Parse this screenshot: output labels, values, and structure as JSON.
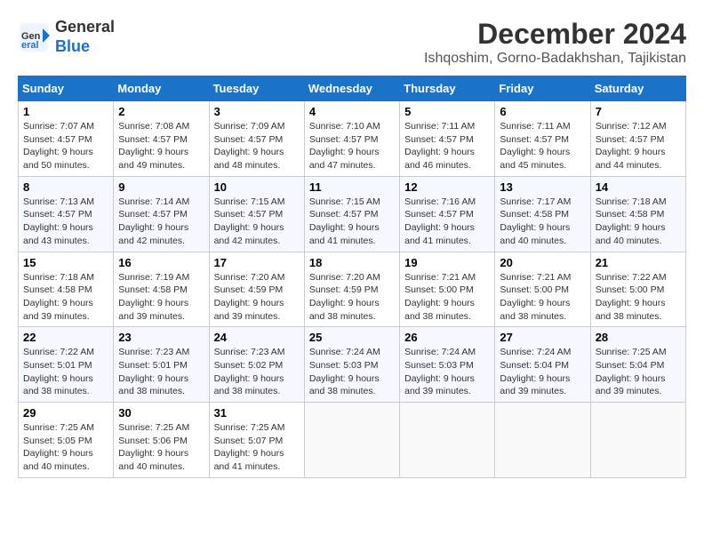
{
  "header": {
    "logo_line1": "General",
    "logo_line2": "Blue",
    "month": "December 2024",
    "location": "Ishqoshim, Gorno-Badakhshan, Tajikistan"
  },
  "weekdays": [
    "Sunday",
    "Monday",
    "Tuesday",
    "Wednesday",
    "Thursday",
    "Friday",
    "Saturday"
  ],
  "weeks": [
    [
      {
        "day": 1,
        "sunrise": "7:07 AM",
        "sunset": "4:57 PM",
        "daylight": "9 hours and 50 minutes"
      },
      {
        "day": 2,
        "sunrise": "7:08 AM",
        "sunset": "4:57 PM",
        "daylight": "9 hours and 49 minutes"
      },
      {
        "day": 3,
        "sunrise": "7:09 AM",
        "sunset": "4:57 PM",
        "daylight": "9 hours and 48 minutes"
      },
      {
        "day": 4,
        "sunrise": "7:10 AM",
        "sunset": "4:57 PM",
        "daylight": "9 hours and 47 minutes"
      },
      {
        "day": 5,
        "sunrise": "7:11 AM",
        "sunset": "4:57 PM",
        "daylight": "9 hours and 46 minutes"
      },
      {
        "day": 6,
        "sunrise": "7:11 AM",
        "sunset": "4:57 PM",
        "daylight": "9 hours and 45 minutes"
      },
      {
        "day": 7,
        "sunrise": "7:12 AM",
        "sunset": "4:57 PM",
        "daylight": "9 hours and 44 minutes"
      }
    ],
    [
      {
        "day": 8,
        "sunrise": "7:13 AM",
        "sunset": "4:57 PM",
        "daylight": "9 hours and 43 minutes"
      },
      {
        "day": 9,
        "sunrise": "7:14 AM",
        "sunset": "4:57 PM",
        "daylight": "9 hours and 42 minutes"
      },
      {
        "day": 10,
        "sunrise": "7:15 AM",
        "sunset": "4:57 PM",
        "daylight": "9 hours and 42 minutes"
      },
      {
        "day": 11,
        "sunrise": "7:15 AM",
        "sunset": "4:57 PM",
        "daylight": "9 hours and 41 minutes"
      },
      {
        "day": 12,
        "sunrise": "7:16 AM",
        "sunset": "4:57 PM",
        "daylight": "9 hours and 41 minutes"
      },
      {
        "day": 13,
        "sunrise": "7:17 AM",
        "sunset": "4:58 PM",
        "daylight": "9 hours and 40 minutes"
      },
      {
        "day": 14,
        "sunrise": "7:18 AM",
        "sunset": "4:58 PM",
        "daylight": "9 hours and 40 minutes"
      }
    ],
    [
      {
        "day": 15,
        "sunrise": "7:18 AM",
        "sunset": "4:58 PM",
        "daylight": "9 hours and 39 minutes"
      },
      {
        "day": 16,
        "sunrise": "7:19 AM",
        "sunset": "4:58 PM",
        "daylight": "9 hours and 39 minutes"
      },
      {
        "day": 17,
        "sunrise": "7:20 AM",
        "sunset": "4:59 PM",
        "daylight": "9 hours and 39 minutes"
      },
      {
        "day": 18,
        "sunrise": "7:20 AM",
        "sunset": "4:59 PM",
        "daylight": "9 hours and 38 minutes"
      },
      {
        "day": 19,
        "sunrise": "7:21 AM",
        "sunset": "5:00 PM",
        "daylight": "9 hours and 38 minutes"
      },
      {
        "day": 20,
        "sunrise": "7:21 AM",
        "sunset": "5:00 PM",
        "daylight": "9 hours and 38 minutes"
      },
      {
        "day": 21,
        "sunrise": "7:22 AM",
        "sunset": "5:00 PM",
        "daylight": "9 hours and 38 minutes"
      }
    ],
    [
      {
        "day": 22,
        "sunrise": "7:22 AM",
        "sunset": "5:01 PM",
        "daylight": "9 hours and 38 minutes"
      },
      {
        "day": 23,
        "sunrise": "7:23 AM",
        "sunset": "5:01 PM",
        "daylight": "9 hours and 38 minutes"
      },
      {
        "day": 24,
        "sunrise": "7:23 AM",
        "sunset": "5:02 PM",
        "daylight": "9 hours and 38 minutes"
      },
      {
        "day": 25,
        "sunrise": "7:24 AM",
        "sunset": "5:03 PM",
        "daylight": "9 hours and 38 minutes"
      },
      {
        "day": 26,
        "sunrise": "7:24 AM",
        "sunset": "5:03 PM",
        "daylight": "9 hours and 39 minutes"
      },
      {
        "day": 27,
        "sunrise": "7:24 AM",
        "sunset": "5:04 PM",
        "daylight": "9 hours and 39 minutes"
      },
      {
        "day": 28,
        "sunrise": "7:25 AM",
        "sunset": "5:04 PM",
        "daylight": "9 hours and 39 minutes"
      }
    ],
    [
      {
        "day": 29,
        "sunrise": "7:25 AM",
        "sunset": "5:05 PM",
        "daylight": "9 hours and 40 minutes"
      },
      {
        "day": 30,
        "sunrise": "7:25 AM",
        "sunset": "5:06 PM",
        "daylight": "9 hours and 40 minutes"
      },
      {
        "day": 31,
        "sunrise": "7:25 AM",
        "sunset": "5:07 PM",
        "daylight": "9 hours and 41 minutes"
      },
      null,
      null,
      null,
      null
    ]
  ]
}
